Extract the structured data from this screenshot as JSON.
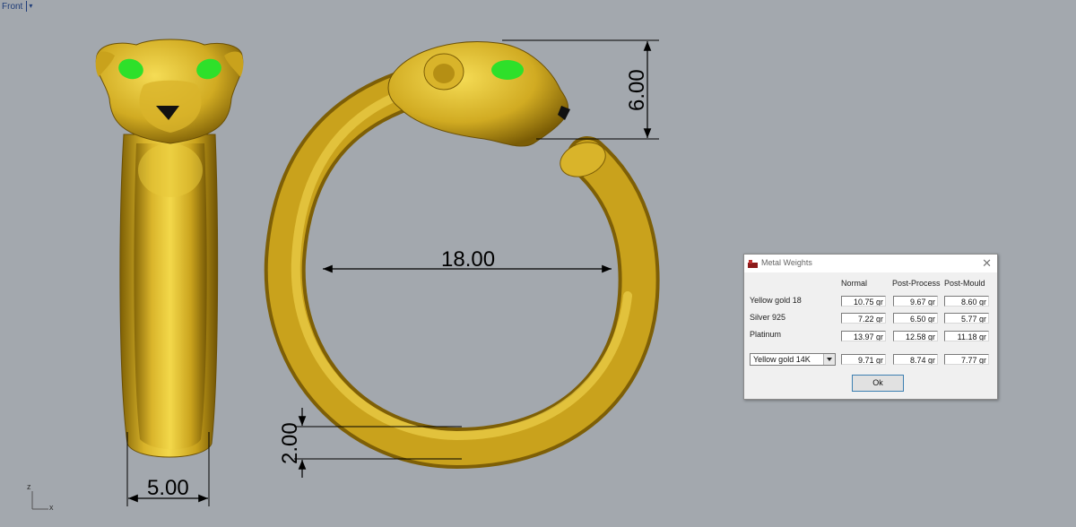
{
  "viewport": {
    "title": "Front",
    "menu_arrow": "▾",
    "axis_z": "z",
    "axis_x": "x"
  },
  "dimensions": {
    "height_label": "6.00",
    "diameter_label": "18.00",
    "thickness_label": "2.00",
    "width_label": "5.00"
  },
  "colors": {
    "background": "#a3a8ae",
    "gold_dark": "#9c7a0a",
    "gold_light": "#f2d545",
    "eye_green": "#2ee02a",
    "nose_black": "#111111"
  },
  "dialog": {
    "title": "Metal Weights",
    "close_icon": "close-icon",
    "columns": [
      "Normal",
      "Post-Process",
      "Post-Mould"
    ],
    "rows": [
      {
        "label": "Yellow gold 18",
        "normal": "10.75 gr",
        "post_process": "9.67 gr",
        "post_mould": "8.60 gr"
      },
      {
        "label": "Silver 925",
        "normal": "7.22 gr",
        "post_process": "6.50 gr",
        "post_mould": "5.77 gr"
      },
      {
        "label": "Platinum",
        "normal": "13.97 gr",
        "post_process": "12.58 gr",
        "post_mould": "11.18 gr"
      }
    ],
    "custom_row": {
      "selected_metal": "Yellow gold 14K",
      "normal": "9.71 gr",
      "post_process": "8.74 gr",
      "post_mould": "7.77 gr"
    },
    "ok_label": "Ok"
  }
}
